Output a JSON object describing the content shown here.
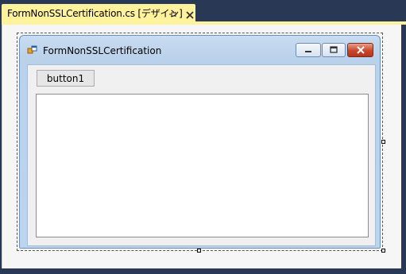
{
  "tab": {
    "title": "FormNonSSLCertification.cs [デザイン]",
    "pin_icon": "pin-icon",
    "close_icon": "close-icon",
    "active_color": "#fff29d"
  },
  "form": {
    "title": "FormNonSSLCertification",
    "icon": "form-app-icon",
    "button1_label": "button1",
    "window_buttons": [
      "minimize",
      "maximize",
      "close"
    ]
  },
  "colors": {
    "ide_background": "#293955",
    "designer_background": "#f6f6f6",
    "close_button": "#c8462b"
  }
}
